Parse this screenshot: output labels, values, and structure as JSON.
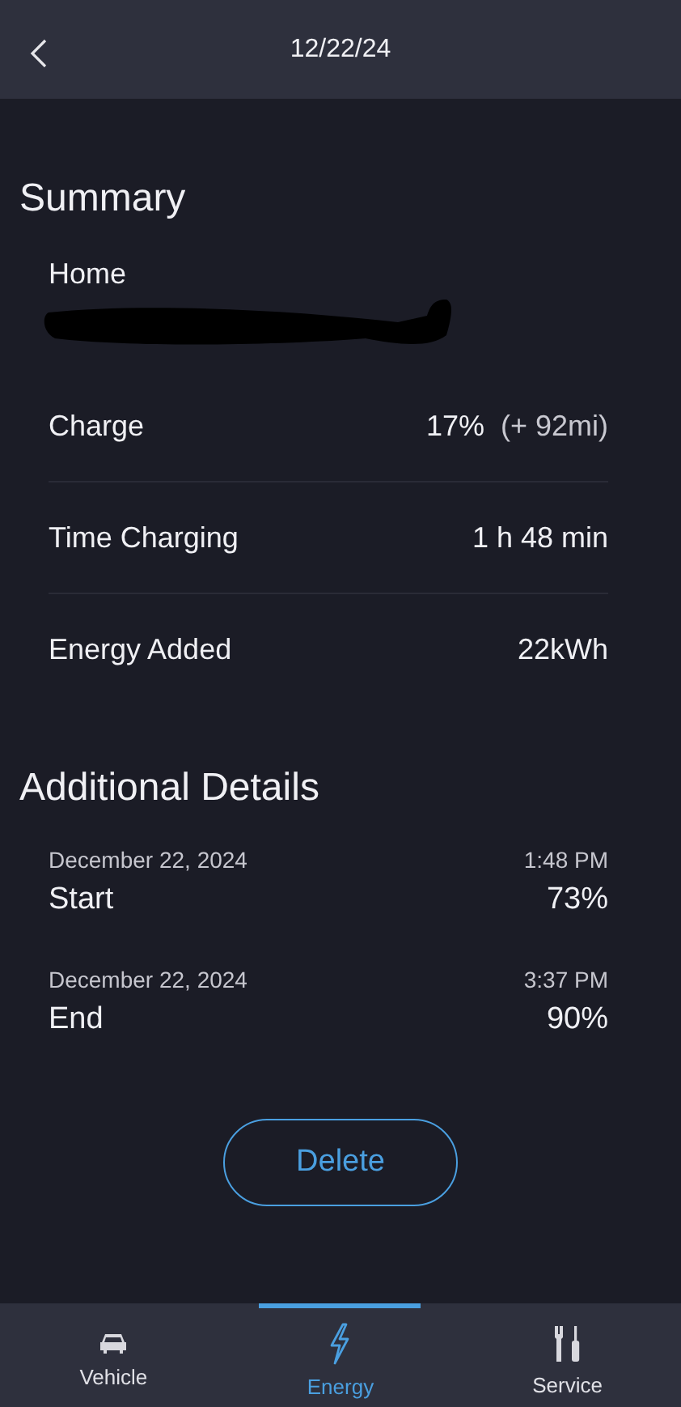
{
  "header": {
    "title": "12/22/24"
  },
  "summary": {
    "title": "Summary",
    "location": {
      "name": "Home",
      "redacted": true
    },
    "rows": [
      {
        "label": "Charge",
        "value": "17%",
        "extra": "(+ 92mi)"
      },
      {
        "label": "Time Charging",
        "value": "1 h 48 min"
      },
      {
        "label": "Energy Added",
        "value": "22kWh"
      }
    ]
  },
  "details": {
    "title": "Additional Details",
    "events": [
      {
        "date": "December 22, 2024",
        "time": "1:48 PM",
        "label": "Start",
        "value": "73%"
      },
      {
        "date": "December 22, 2024",
        "time": "3:37 PM",
        "label": "End",
        "value": "90%"
      }
    ]
  },
  "delete_button": "Delete",
  "nav": [
    {
      "label": "Vehicle",
      "kind": "car",
      "selected": false
    },
    {
      "label": "Energy",
      "kind": "bolt",
      "selected": true
    },
    {
      "label": "Service",
      "kind": "tools",
      "selected": false
    }
  ]
}
